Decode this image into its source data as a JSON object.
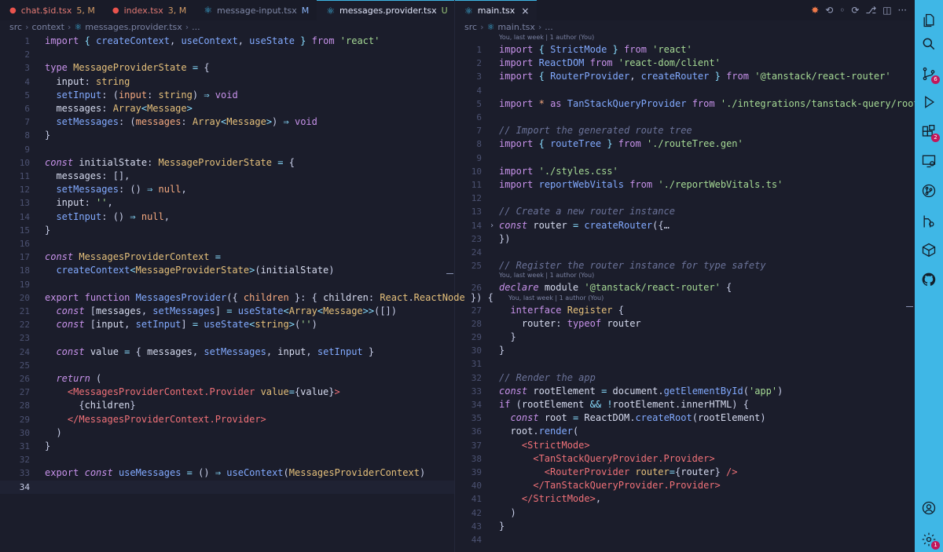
{
  "left_tabs": [
    {
      "label": "chat.$id.tsx",
      "status": "5, M",
      "icon": "error-dot-icon"
    },
    {
      "label": "index.tsx",
      "status": "3, M",
      "icon": "error-dot-icon"
    },
    {
      "label": "message-input.tsx",
      "status": "M",
      "icon": "react-icon"
    },
    {
      "label": "messages.provider.tsx",
      "status": "U",
      "icon": "react-icon"
    }
  ],
  "right_tabs": [
    {
      "label": "main.tsx",
      "icon": "react-icon"
    }
  ],
  "more_symbol": "···",
  "close_symbol": "×",
  "left_breadcrumb": [
    "src",
    "context",
    "messages.provider.tsx",
    "..."
  ],
  "right_breadcrumb": [
    "src",
    "main.tsx",
    "..."
  ],
  "right_blame": [
    {
      "before_line": 1,
      "text": "You, last week | 1 author (You)"
    },
    {
      "before_line": 26,
      "text": "You, last week | 1 author (You)"
    },
    {
      "before_line": 27,
      "text": "You, last week | 1 author (You)"
    }
  ],
  "left_lines": [
    {
      "n": "1",
      "html": "<span class=\"k\">import</span> <span class=\"op\">{</span> <span class=\"f\">createContext</span>, <span class=\"f\">useContext</span>, <span class=\"f\">useState</span> <span class=\"op\">}</span> <span class=\"k\">from</span> <span class=\"s\">'react'</span>"
    },
    {
      "n": "2",
      "html": ""
    },
    {
      "n": "3",
      "html": "<span class=\"k\">type</span> <span class=\"t\">MessageProviderState</span> <span class=\"op\">=</span> {"
    },
    {
      "n": "4",
      "html": "  <span class=\"w\">input</span>: <span class=\"t\">string</span>"
    },
    {
      "n": "5",
      "html": "  <span class=\"f\">setInput</span>: (<span class=\"kw2\">input</span>: <span class=\"t\">string</span>) <span class=\"op\">⇒</span> <span class=\"k\">void</span>"
    },
    {
      "n": "6",
      "html": "  <span class=\"w\">messages</span>: <span class=\"t\">Array</span><span class=\"op\">&lt;</span><span class=\"t\">Message</span><span class=\"op\">&gt;</span>"
    },
    {
      "n": "7",
      "html": "  <span class=\"f\">setMessages</span>: (<span class=\"kw2\">messages</span>: <span class=\"t\">Array</span><span class=\"op\">&lt;</span><span class=\"t\">Message</span><span class=\"op\">&gt;</span>) <span class=\"op\">⇒</span> <span class=\"k\">void</span>"
    },
    {
      "n": "8",
      "html": "}"
    },
    {
      "n": "9",
      "html": ""
    },
    {
      "n": "10",
      "html": "<span class=\"ki\">const</span> <span class=\"w\">initialState</span>: <span class=\"t\">MessageProviderState</span> <span class=\"op\">=</span> {"
    },
    {
      "n": "11",
      "html": "  <span class=\"w\">messages</span>: [],"
    },
    {
      "n": "12",
      "html": "  <span class=\"f\">setMessages</span>: () <span class=\"op\">⇒</span> <span class=\"kw2\">null</span>,"
    },
    {
      "n": "13",
      "html": "  <span class=\"w\">input</span>: <span class=\"s\">''</span>,"
    },
    {
      "n": "14",
      "html": "  <span class=\"f\">setInput</span>: () <span class=\"op\">⇒</span> <span class=\"kw2\">null</span>,"
    },
    {
      "n": "15",
      "html": "}"
    },
    {
      "n": "16",
      "html": ""
    },
    {
      "n": "17",
      "html": "<span class=\"ki\">const</span> <span class=\"t\">MessagesProviderContext</span> <span class=\"op\">=</span>"
    },
    {
      "n": "18",
      "html": "  <span class=\"f\">createContext</span><span class=\"op\">&lt;</span><span class=\"t\">MessageProviderState</span><span class=\"op\">&gt;</span>(<span class=\"w\">initialState</span>)"
    },
    {
      "n": "19",
      "html": ""
    },
    {
      "n": "20",
      "html": "<span class=\"k\">export</span> <span class=\"k\">function</span> <span class=\"f\">MessagesProvider</span>({ <span class=\"kw2\">children</span> }: { <span class=\"w\">children</span>: <span class=\"t\">React</span>.<span class=\"t\">ReactNode</span> }) {"
    },
    {
      "n": "21",
      "html": "  <span class=\"ki\">const</span> [<span class=\"w\">messages</span>, <span class=\"f\">setMessages</span>] <span class=\"op\">=</span> <span class=\"f\">useState</span><span class=\"op\">&lt;</span><span class=\"t\">Array</span><span class=\"op\">&lt;</span><span class=\"t\">Message</span><span class=\"op\">&gt;&gt;</span>([])"
    },
    {
      "n": "22",
      "html": "  <span class=\"ki\">const</span> [<span class=\"w\">input</span>, <span class=\"f\">setInput</span>] <span class=\"op\">=</span> <span class=\"f\">useState</span><span class=\"op\">&lt;</span><span class=\"t\">string</span><span class=\"op\">&gt;</span>(<span class=\"s\">''</span>)"
    },
    {
      "n": "23",
      "html": ""
    },
    {
      "n": "24",
      "html": "  <span class=\"ki\">const</span> <span class=\"w\">value</span> <span class=\"op\">=</span> { <span class=\"w\">messages</span>, <span class=\"f\">setMessages</span>, <span class=\"w\">input</span>, <span class=\"f\">setInput</span> }"
    },
    {
      "n": "25",
      "html": ""
    },
    {
      "n": "26",
      "html": "  <span class=\"ki\">return</span> ("
    },
    {
      "n": "27",
      "html": "    <span class=\"tag\">&lt;MessagesProviderContext.Provider</span> <span class=\"t\">value</span><span class=\"op\">=</span>{<span class=\"w\">value</span>}<span class=\"tag\">&gt;</span>"
    },
    {
      "n": "28",
      "html": "      {<span class=\"w\">children</span>}"
    },
    {
      "n": "29",
      "html": "    <span class=\"tag\">&lt;/MessagesProviderContext.Provider&gt;</span>"
    },
    {
      "n": "30",
      "html": "  )"
    },
    {
      "n": "31",
      "html": "}"
    },
    {
      "n": "32",
      "html": ""
    },
    {
      "n": "33",
      "html": "<span class=\"k\">export</span> <span class=\"ki\">const</span> <span class=\"f\">useMessages</span> <span class=\"op\">=</span> () <span class=\"op\">⇒</span> <span class=\"f\">useContext</span>(<span class=\"t\">MessagesProviderContext</span>)"
    },
    {
      "n": "34",
      "html": "",
      "current": true
    }
  ],
  "right_lines": [
    {
      "n": "1",
      "html": "<span class=\"k\">import</span> <span class=\"op\">{</span> <span class=\"f\">StrictMode</span> <span class=\"op\">}</span> <span class=\"k\">from</span> <span class=\"s\">'react'</span>"
    },
    {
      "n": "2",
      "html": "<span class=\"k\">import</span> <span class=\"f\">ReactDOM</span> <span class=\"k\">from</span> <span class=\"s\">'react-dom/client'</span>"
    },
    {
      "n": "3",
      "html": "<span class=\"k\">import</span> <span class=\"op\">{</span> <span class=\"f\">RouterProvider</span>, <span class=\"f\">createRouter</span> <span class=\"op\">}</span> <span class=\"k\">from</span> <span class=\"s\">'@tanstack/react-router'</span>"
    },
    {
      "n": "4",
      "html": ""
    },
    {
      "n": "5",
      "html": "<span class=\"k\">import</span> <span class=\"kw2\">*</span> <span class=\"k\">as</span> <span class=\"f\">TanStackQueryProvider</span> <span class=\"k\">from</span> <span class=\"s\">'./integrations/tanstack-query/root-provider.tsx'</span>"
    },
    {
      "n": "6",
      "html": ""
    },
    {
      "n": "7",
      "html": "<span class=\"c\">// Import the generated route tree</span>"
    },
    {
      "n": "8",
      "html": "<span class=\"k\">import</span> <span class=\"op\">{</span> <span class=\"f\">routeTree</span> <span class=\"op\">}</span> <span class=\"k\">from</span> <span class=\"s\">'./routeTree.gen'</span>"
    },
    {
      "n": "9",
      "html": ""
    },
    {
      "n": "10",
      "html": "<span class=\"k\">import</span> <span class=\"s\">'./styles.css'</span>"
    },
    {
      "n": "11",
      "html": "<span class=\"k\">import</span> <span class=\"f\">reportWebVitals</span> <span class=\"k\">from</span> <span class=\"s\">'./reportWebVitals.ts'</span>"
    },
    {
      "n": "12",
      "html": ""
    },
    {
      "n": "13",
      "html": "<span class=\"c\">// Create a new router instance</span>"
    },
    {
      "n": "14",
      "html": "<span class=\"ki\">const</span> <span class=\"w\">router</span> <span class=\"op\">=</span> <span class=\"f\">createRouter</span>({<span class=\"w\">…</span>",
      "fold": true
    },
    {
      "n": "23",
      "html": "})"
    },
    {
      "n": "24",
      "html": ""
    },
    {
      "n": "25",
      "html": "<span class=\"c\">// Register the router instance for type safety</span>"
    },
    {
      "n": "26",
      "html": "<span class=\"ki\">declare</span> <span class=\"w\">module</span> <span class=\"s\">'@tanstack/react-router'</span> {"
    },
    {
      "n": "27",
      "html": "  <span class=\"k\">interface</span> <span class=\"t\">Register</span> {"
    },
    {
      "n": "28",
      "html": "    <span class=\"w\">router</span>: <span class=\"k\">typeof</span> <span class=\"w\">router</span>"
    },
    {
      "n": "29",
      "html": "  }"
    },
    {
      "n": "30",
      "html": "}"
    },
    {
      "n": "31",
      "html": ""
    },
    {
      "n": "32",
      "html": "<span class=\"c\">// Render the app</span>"
    },
    {
      "n": "33",
      "html": "<span class=\"ki\">const</span> <span class=\"w\">rootElement</span> <span class=\"op\">=</span> <span class=\"w\">document</span>.<span class=\"f\">getElementById</span>(<span class=\"s\">'app'</span>)"
    },
    {
      "n": "34",
      "html": "<span class=\"k\">if</span> (<span class=\"w\">rootElement</span> <span class=\"op\">&amp;&amp;</span> <span class=\"op\">!</span><span class=\"w\">rootElement</span>.<span class=\"w\">innerHTML</span>) {"
    },
    {
      "n": "35",
      "html": "  <span class=\"ki\">const</span> <span class=\"w\">root</span> <span class=\"op\">=</span> <span class=\"w\">ReactDOM</span>.<span class=\"f\">createRoot</span>(<span class=\"w\">rootElement</span>)"
    },
    {
      "n": "36",
      "html": "  <span class=\"w\">root</span>.<span class=\"f\">render</span>("
    },
    {
      "n": "37",
      "html": "    <span class=\"tag\">&lt;StrictMode&gt;</span>"
    },
    {
      "n": "38",
      "html": "      <span class=\"tag\">&lt;TanStackQueryProvider.Provider&gt;</span>"
    },
    {
      "n": "39",
      "html": "        <span class=\"tag\">&lt;RouterProvider</span> <span class=\"t\">router</span><span class=\"op\">=</span>{<span class=\"w\">router</span>} <span class=\"tag\">/&gt;</span>"
    },
    {
      "n": "40",
      "html": "      <span class=\"tag\">&lt;/TanStackQueryProvider.Provider&gt;</span>"
    },
    {
      "n": "41",
      "html": "    <span class=\"tag\">&lt;/StrictMode&gt;</span>,"
    },
    {
      "n": "42",
      "html": "  )"
    },
    {
      "n": "43",
      "html": "}"
    },
    {
      "n": "44",
      "html": ""
    }
  ],
  "activity_bar": [
    {
      "name": "explorer-icon"
    },
    {
      "name": "search-icon"
    },
    {
      "name": "source-control-icon",
      "badge": "6"
    },
    {
      "name": "run-debug-icon"
    },
    {
      "name": "extensions-icon",
      "badge": "2"
    },
    {
      "name": "remote-explorer-icon"
    },
    {
      "name": "git-graph-icon"
    },
    {
      "name": "git-lens-icon"
    },
    {
      "name": "containers-icon"
    },
    {
      "name": "github-icon"
    },
    {
      "name": "account-icon"
    },
    {
      "name": "settings-gear-icon",
      "badge": "1"
    }
  ],
  "colors": {
    "accent": "#3fb7e6",
    "background": "#1b1d2b",
    "badge": "#c2185b"
  }
}
